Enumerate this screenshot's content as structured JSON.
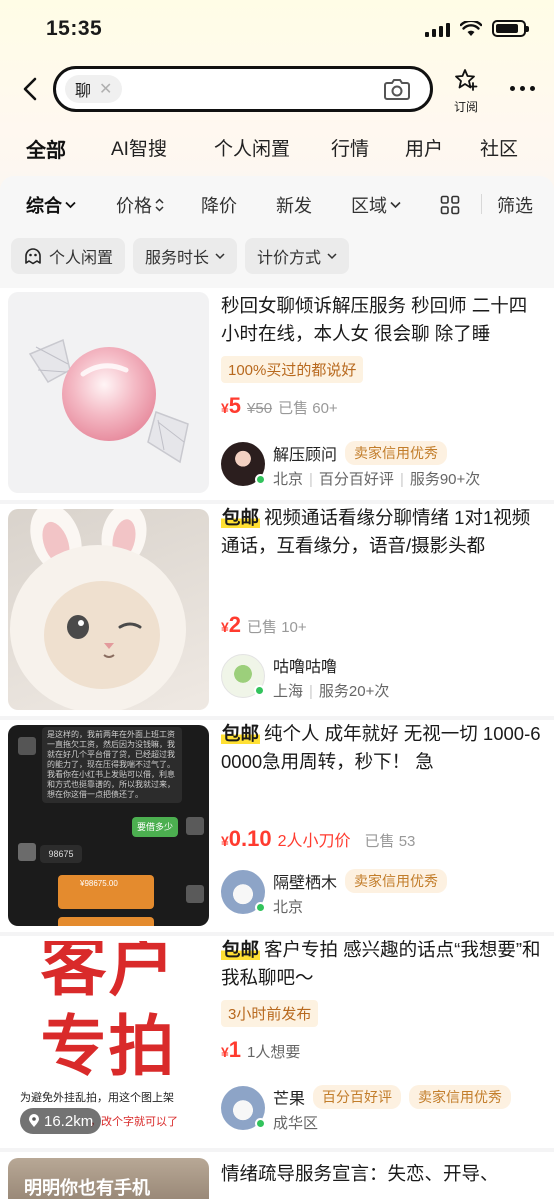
{
  "status_bar": {
    "time": "15:35"
  },
  "search": {
    "query": "聊",
    "subscribe_label": "订阅"
  },
  "category_tabs": [
    {
      "label": "全部",
      "active": true
    },
    {
      "label": "AI智搜"
    },
    {
      "label": "个人闲置"
    },
    {
      "label": "行情"
    },
    {
      "label": "用户"
    },
    {
      "label": "社区"
    }
  ],
  "sort_bar": [
    {
      "label": "综合",
      "active": true,
      "icon": "chevron-down-icon"
    },
    {
      "label": "价格",
      "icon": "sort-updown-icon"
    },
    {
      "label": "降价"
    },
    {
      "label": "新发"
    },
    {
      "label": "区域",
      "icon": "chevron-down-icon"
    },
    {
      "label": "",
      "icon": "grid-view-icon"
    },
    {
      "label": "筛选"
    }
  ],
  "filter_chips": [
    {
      "label": "个人闲置",
      "icon": "ghost-icon"
    },
    {
      "label": "服务时长",
      "icon": "chevron-down-icon"
    },
    {
      "label": "计价方式",
      "icon": "chevron-down-icon"
    }
  ],
  "listings": [
    {
      "free_shipping": "",
      "title": "秒回女聊倾诉解压服务 秒回师 二十四小时在线，本人女 很会聊 除了睡",
      "promo_tag": "100%买过的都说好",
      "currency": "¥",
      "price": "5",
      "original_price": "¥50",
      "price_note": "",
      "sold": "已售 60+",
      "seller": {
        "name": "解压顾问",
        "badges": [
          "卖家信用优秀"
        ],
        "meta": [
          "北京",
          "百分百好评",
          "服务90+次"
        ]
      }
    },
    {
      "free_shipping": "包邮",
      "title": "视频通话看缘分聊情绪 1对1视频通话，互看缘分，语音/摄影头都",
      "promo_tag": "",
      "currency": "¥",
      "price": "2",
      "original_price": "",
      "price_note": "",
      "sold": "已售 10+",
      "seller": {
        "name": "咕噜咕噜",
        "badges": [],
        "meta": [
          "上海",
          "服务20+次"
        ]
      }
    },
    {
      "free_shipping": "包邮",
      "title": "纯个人 成年就好 无视一切 1000-60000急用周转，秒下！  急",
      "promo_tag": "",
      "currency": "¥",
      "price": "0.10",
      "original_price": "",
      "price_note": "2人小刀价",
      "sold": "已售 53",
      "seller": {
        "name": "隔壁栖木",
        "badges": [
          "卖家信用优秀"
        ],
        "meta": [
          "北京"
        ]
      },
      "image_text": {
        "chat_line": "是这样的，我前两年在外面上班工资一直拖欠工资，然后因为没钱嘛，我就在好几个平台借了贷，已经超过我的能力了，现在压得我喘不过气了。我看你在小红书上发贴可以借，利息和方式也挺靠谱的，所以我就过来，想在你这借一点把债还了。",
        "reply": "要借多少",
        "amount": "98675",
        "transfer": "¥98675.00"
      }
    },
    {
      "free_shipping": "包邮",
      "title": "客户专拍 感兴趣的话点“我想要”和我私聊吧～",
      "promo_tag": "3小时前发布",
      "currency": "¥",
      "price": "1",
      "original_price": "",
      "price_note": "",
      "sold": "1人想要",
      "seller": {
        "name": "芒果",
        "badges": [
          "百分百好评",
          "卖家信用优秀"
        ],
        "meta": [
          "成华区"
        ]
      },
      "distance": "16.2km",
      "image_text": {
        "big": "客户专拍",
        "small": "为避免外挂乱拍，用这个图上架",
        "small2": "，改个字就可以了"
      }
    },
    {
      "free_shipping": "",
      "title": "情绪疏导服务宣言：失恋、开导、",
      "image_text": {
        "caption": "明明你也有手机"
      }
    }
  ]
}
